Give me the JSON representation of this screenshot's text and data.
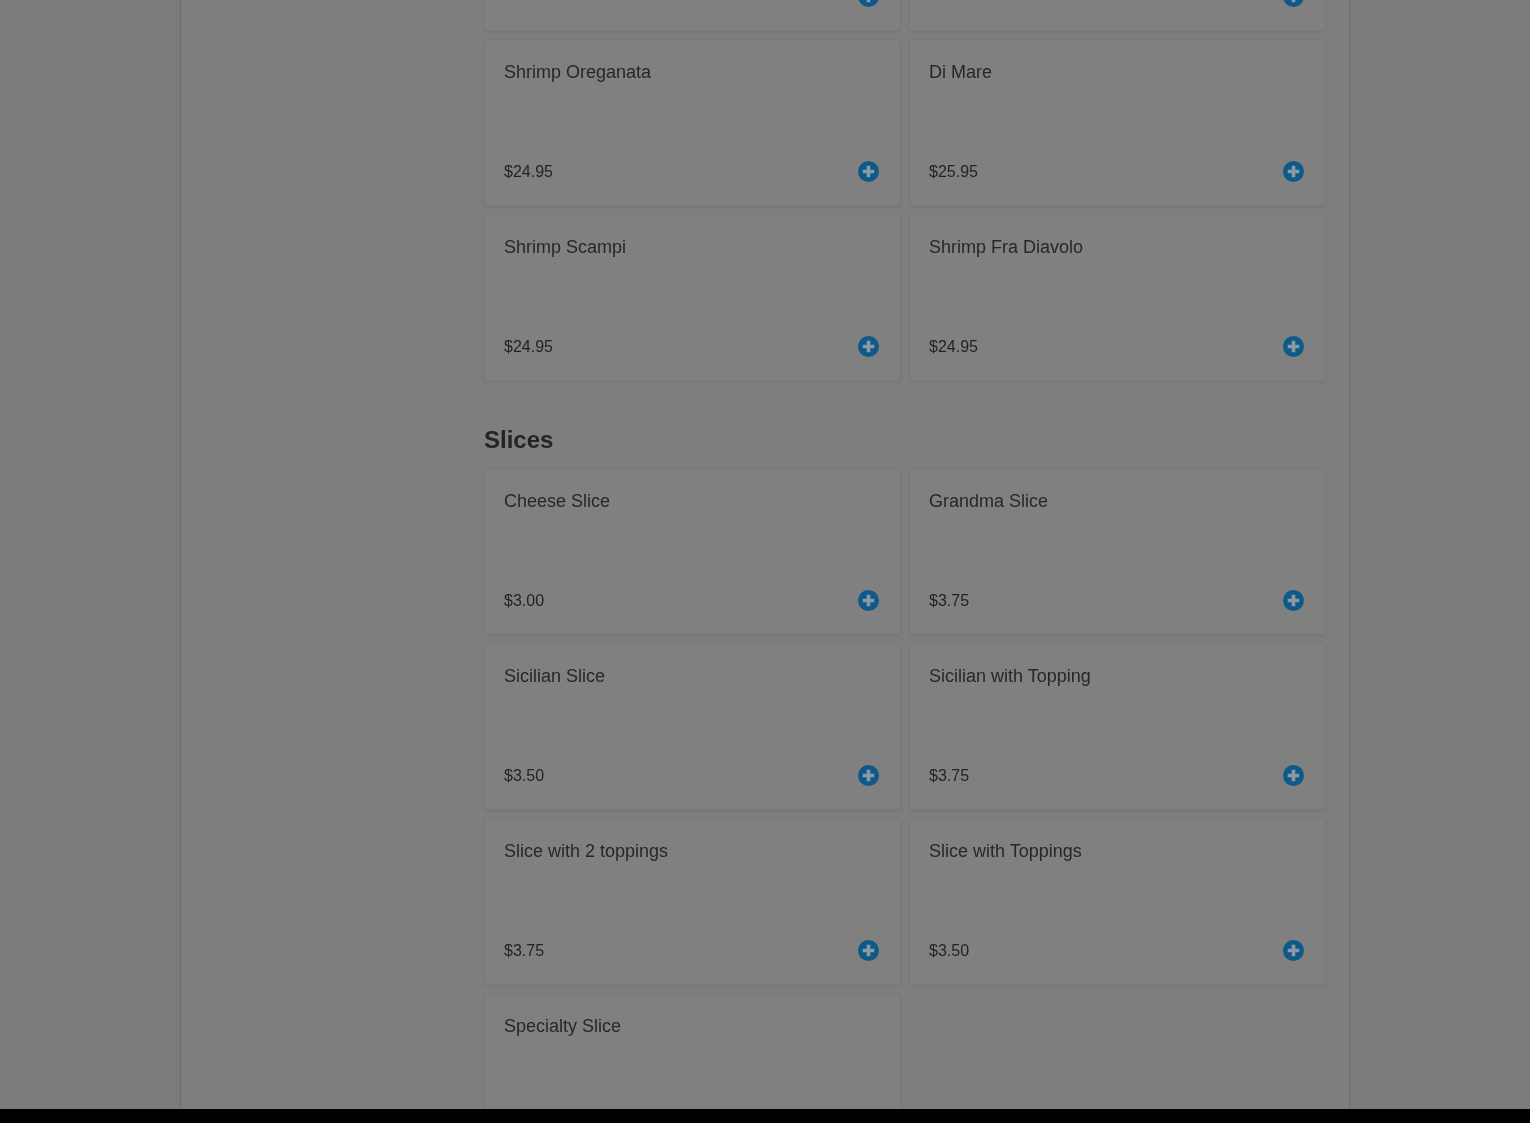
{
  "sections": [
    {
      "items": [
        {
          "kind": "partial"
        },
        {
          "kind": "partial"
        },
        {
          "kind": "full",
          "name": "Shrimp Oreganata",
          "price": "$24.95"
        },
        {
          "kind": "full",
          "name": "Di Mare",
          "price": "$25.95"
        },
        {
          "kind": "full",
          "name": "Shrimp Scampi",
          "price": "$24.95"
        },
        {
          "kind": "full",
          "name": "Shrimp Fra Diavolo",
          "price": "$24.95"
        }
      ]
    },
    {
      "title": "Slices",
      "items": [
        {
          "kind": "full",
          "name": "Cheese Slice",
          "price": "$3.00"
        },
        {
          "kind": "full",
          "name": "Grandma Slice",
          "price": "$3.75"
        },
        {
          "kind": "full",
          "name": "Sicilian Slice",
          "price": "$3.50"
        },
        {
          "kind": "full",
          "name": "Sicilian with Topping",
          "price": "$3.75"
        },
        {
          "kind": "full",
          "name": "Slice with 2 toppings",
          "price": "$3.75"
        },
        {
          "kind": "full",
          "name": "Slice with Toppings",
          "price": "$3.50"
        },
        {
          "kind": "cut",
          "name": "Specialty Slice"
        }
      ]
    }
  ]
}
